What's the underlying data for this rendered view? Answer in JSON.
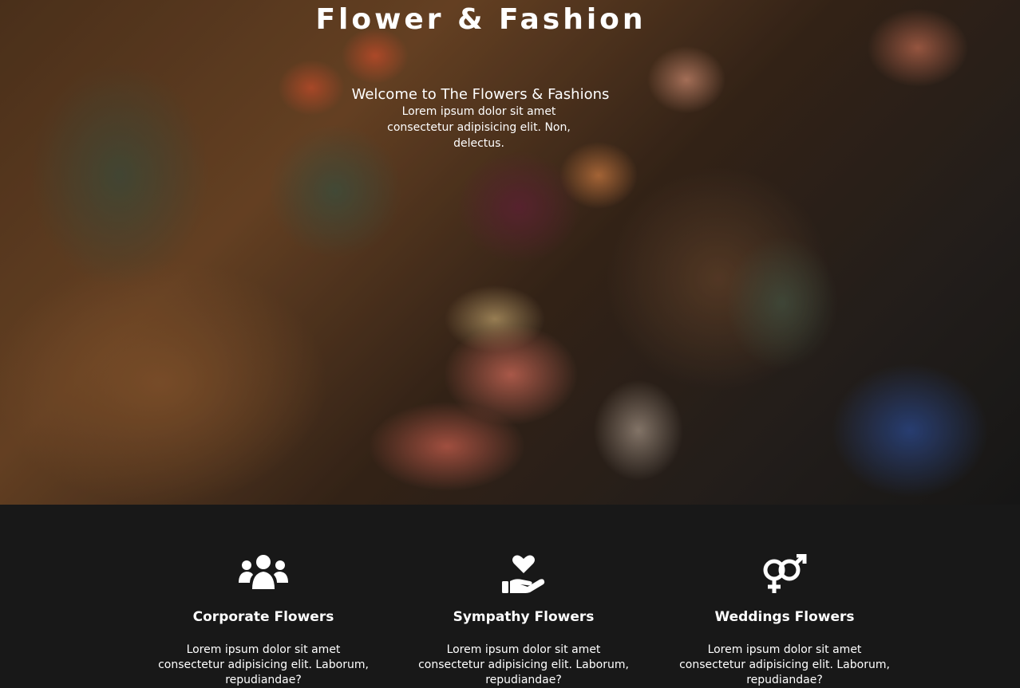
{
  "hero": {
    "title": "Flower & Fashion",
    "welcome_heading": "Welcome to The Flowers & Fashions",
    "welcome_text": "Lorem ipsum dolor sit amet consectetur adipisicing elit. Non, delectus."
  },
  "features": [
    {
      "icon": "users-group-icon",
      "title": "Corporate Flowers",
      "text": "Lorem ipsum dolor sit amet consectetur adipisicing elit. Laborum, repudiandae?"
    },
    {
      "icon": "hand-holding-heart-icon",
      "title": "Sympathy Flowers",
      "text": "Lorem ipsum dolor sit amet consectetur adipisicing elit. Laborum, repudiandae?"
    },
    {
      "icon": "venus-mars-icon",
      "title": "Weddings Flowers",
      "text": "Lorem ipsum dolor sit amet consectetur adipisicing elit. Laborum, repudiandae?"
    }
  ],
  "colors": {
    "footer_background": "#181818",
    "text": "#ffffff"
  }
}
